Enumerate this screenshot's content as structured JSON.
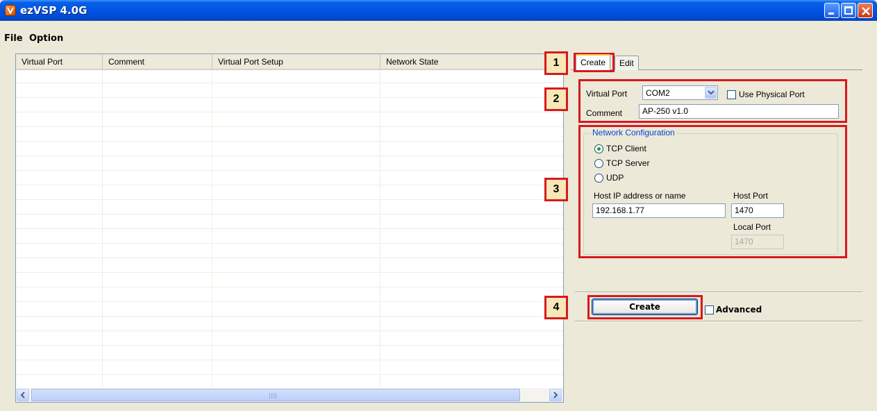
{
  "window": {
    "title": "ezVSP 4.0G"
  },
  "menu": [
    "File",
    "Option"
  ],
  "list": {
    "columns": [
      "Virtual Port",
      "Comment",
      "Virtual Port Setup",
      "Network State"
    ]
  },
  "tabs": {
    "create": "Create",
    "edit": "Edit"
  },
  "form": {
    "virtual_port_label": "Virtual Port",
    "virtual_port_value": "COM2",
    "use_physical_label": "Use Physical Port",
    "comment_label": "Comment",
    "comment_value": "AP-250 v1.0",
    "network_config_label": "Network Configuration",
    "radios": [
      "TCP Client",
      "TCP Server",
      "UDP"
    ],
    "selected_radio": "TCP Client",
    "host_ip_label": "Host IP address or name",
    "host_ip_value": "192.168.1.77",
    "host_port_label": "Host Port",
    "host_port_value": "1470",
    "local_port_label": "Local Port",
    "local_port_value": "1470",
    "create_button": "Create",
    "advanced_label": "Advanced"
  },
  "annotations": [
    "1",
    "2",
    "3",
    "4"
  ]
}
